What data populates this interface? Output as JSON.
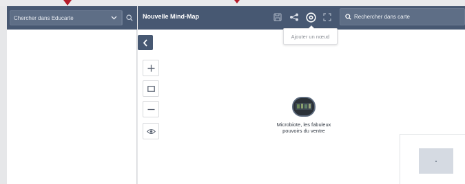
{
  "sidebar": {
    "search_placeholder": "Chercher dans Educarte"
  },
  "header": {
    "title": "Nouvelle Mind-Map",
    "search_placeholder": "Rechercher dans carte"
  },
  "tooltip": {
    "text": "Ajouter un nœud"
  },
  "mindmap": {
    "node_label_line1": "Microbiote, les fabuleux",
    "node_label_line2": "pouvoirs du ventre"
  },
  "icons": {
    "save": "save-icon",
    "share": "share-icon",
    "add_node": "add-node-icon",
    "fullscreen": "fullscreen-icon",
    "collapse": "chevron-left-icon",
    "zoom_in": "plus-icon",
    "fit": "rectangle-icon",
    "zoom_out": "minus-icon",
    "view": "eye-icon"
  },
  "colors": {
    "header_bg": "#475872",
    "search_bg": "#5e6e86",
    "pointer": "#b51d2a"
  }
}
